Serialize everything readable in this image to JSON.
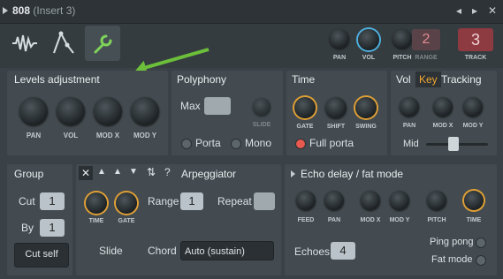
{
  "window": {
    "title": "808",
    "insert": "(Insert 3)"
  },
  "toolbar": {
    "tabs": [
      "waveform-icon",
      "envelope-icon",
      "wrench-icon"
    ],
    "pan": "PAN",
    "vol": "VOL",
    "pitch": "PITCH",
    "range_label": "RANGE",
    "range_value": "2",
    "track_label": "TRACK",
    "track_value": "3"
  },
  "levels": {
    "title": "Levels adjustment",
    "knobs": [
      "PAN",
      "VOL",
      "MOD X",
      "MOD Y"
    ]
  },
  "polyphony": {
    "title": "Polyphony",
    "max": "Max",
    "slide": "SLIDE",
    "porta": "Porta",
    "mono": "Mono"
  },
  "time": {
    "title": "Time",
    "knobs": [
      "GATE",
      "SHIFT",
      "SWING"
    ],
    "full_porta": "Full porta"
  },
  "vkt": {
    "vol": "Vol",
    "key": "Key",
    "tracking": "Tracking",
    "knobs": [
      "PAN",
      "MOD X",
      "MOD Y"
    ],
    "mid": "Mid"
  },
  "group": {
    "title": "Group",
    "cut": "Cut",
    "cut_value": "1",
    "by": "By",
    "by_value": "1",
    "cut_self": "Cut self"
  },
  "arp": {
    "title": "Arpeggiator",
    "knobs": [
      "TIME",
      "GATE"
    ],
    "range": "Range",
    "range_value": "1",
    "repeat": "Repeat",
    "slide": "Slide",
    "chord": "Chord",
    "chord_value": "Auto (sustain)"
  },
  "echo": {
    "title": "Echo delay / fat mode",
    "knobs": [
      "FEED",
      "PAN",
      "MOD X",
      "MOD Y",
      "PITCH",
      "TIME"
    ],
    "echoes": "Echoes",
    "echoes_value": "4",
    "ping_pong": "Ping pong",
    "fat_mode": "Fat mode"
  },
  "colors": {
    "accent_orange": "#e0a035",
    "accent_blue": "#4fb0e0",
    "arrow_green": "#6cbf3a",
    "track_red": "#c0404a"
  }
}
